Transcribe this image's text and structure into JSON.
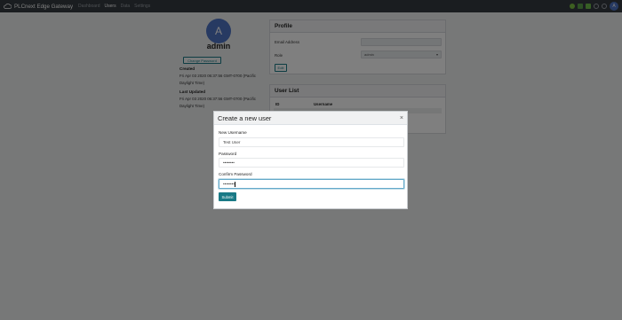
{
  "nav": {
    "brand": "PLCnext Edge Gateway",
    "links": [
      "Dashboard",
      "Users",
      "Data",
      "Settings"
    ],
    "avatar": "A"
  },
  "user": {
    "avatar": "A",
    "name": "admin",
    "change_password": "Change Password",
    "created_label": "Created",
    "created_value": "Fri Apr 03 2020 06:37:56 GMT-0700 (Pacific Daylight Time)",
    "updated_label": "Last Updated",
    "updated_value": "Fri Apr 03 2020 06:37:56 GMT-0700 (Pacific Daylight Time)"
  },
  "profile": {
    "title": "Profile",
    "email_label": "Email Address",
    "email_value": "",
    "role_label": "Role",
    "role_value": "admin",
    "edit_label": "Edit"
  },
  "user_list": {
    "title": "User List",
    "columns": [
      "ID",
      "Username"
    ]
  },
  "modal": {
    "title": "Create a new user",
    "close": "×",
    "username_label": "New Username",
    "username_value": "Test User",
    "password_label": "Password",
    "password_value": "••••••••",
    "confirm_label": "Confirm Password",
    "confirm_value": "••••••••",
    "submit_label": "Submit"
  },
  "colors": {
    "navbar": "#343a40",
    "accent": "#1a7a86",
    "avatar": "#4f74c4"
  }
}
